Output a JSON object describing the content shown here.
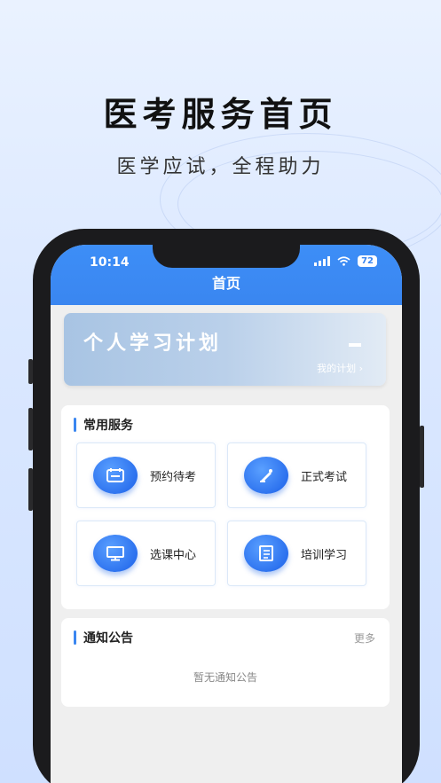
{
  "hero": {
    "title": "医考服务首页",
    "subtitle": "医学应试，全程助力"
  },
  "status_bar": {
    "time": "10:14",
    "battery": "72"
  },
  "nav": {
    "title": "首页"
  },
  "plan_banner": {
    "title": "个人学习计划",
    "link": "我的计划 ›"
  },
  "services": {
    "title": "常用服务",
    "items": [
      {
        "label": "预约待考",
        "icon": "calendar-icon"
      },
      {
        "label": "正式考试",
        "icon": "exam-pen-icon"
      },
      {
        "label": "选课中心",
        "icon": "course-screen-icon"
      },
      {
        "label": "培训学习",
        "icon": "book-icon"
      }
    ]
  },
  "notices": {
    "title": "通知公告",
    "more": "更多",
    "empty": "暂无通知公告"
  },
  "colors": {
    "accent": "#3a86f0",
    "icon_gradient_start": "#5aa0ff",
    "icon_gradient_end": "#1a5fe8"
  }
}
